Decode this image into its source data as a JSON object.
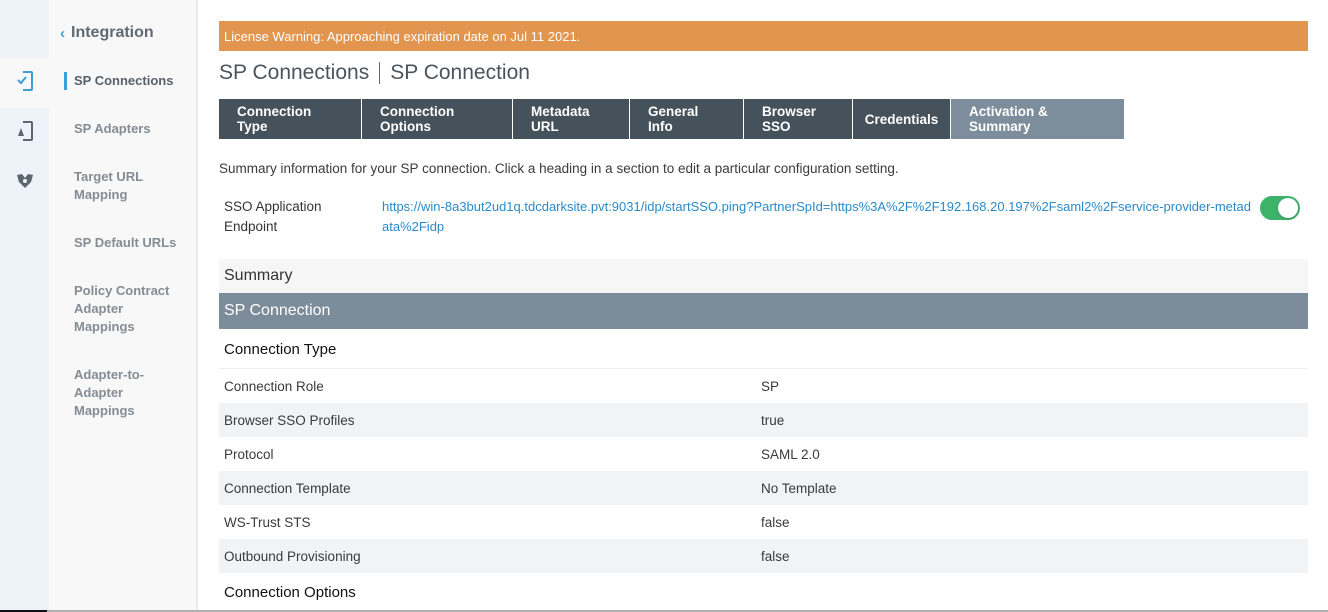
{
  "rail": {
    "items": [
      {
        "icon": "sp-connections-icon",
        "active": true
      },
      {
        "icon": "sp-adapters-icon",
        "active": false
      },
      {
        "icon": "mappings-icon",
        "active": false
      }
    ]
  },
  "subnav": {
    "back_label": "Integration",
    "back_icon": "chevron-left-icon",
    "items": [
      {
        "label": "SP Connections",
        "active": true
      },
      {
        "label": "SP Adapters",
        "active": false
      },
      {
        "label": "Target URL Mapping",
        "active": false
      },
      {
        "label": "SP Default URLs",
        "active": false
      },
      {
        "label": "Policy Contract Adapter Mappings",
        "active": false
      },
      {
        "label": "Adapter-to-Adapter Mappings",
        "active": false
      }
    ]
  },
  "license_warning": "License Warning: Approaching expiration date on Jul 11 2021.",
  "title": {
    "parent": "SP Connections",
    "current": "SP Connection"
  },
  "tabs": [
    {
      "label": "Connection Type",
      "active": false
    },
    {
      "label": "Connection Options",
      "active": false
    },
    {
      "label": "Metadata URL",
      "active": false
    },
    {
      "label": "General Info",
      "active": false
    },
    {
      "label": "Browser SSO",
      "active": false
    },
    {
      "label": "Credentials",
      "active": false
    },
    {
      "label": "Activation & Summary",
      "active": true
    }
  ],
  "intro": "Summary information for your SP connection. Click a heading in a section to edit a particular configuration setting.",
  "sso_endpoint": {
    "label": "SSO Application Endpoint",
    "url": "https://win-8a3but2ud1q.tdcdarksite.pvt:9031/idp/startSSO.ping?PartnerSpId=https%3A%2F%2F192.168.20.197%2Fsaml2%2Fservice-provider-metadata%2Fidp",
    "enabled": true,
    "toggle_color": "#3db36a"
  },
  "summary": {
    "header": "Summary",
    "connection_header": "SP Connection",
    "sections": [
      {
        "title": "Connection Type",
        "rows": [
          {
            "label": "Connection Role",
            "value": "SP"
          },
          {
            "label": "Browser SSO Profiles",
            "value": "true"
          },
          {
            "label": "Protocol",
            "value": "SAML 2.0"
          },
          {
            "label": "Connection Template",
            "value": "No Template"
          },
          {
            "label": "WS-Trust STS",
            "value": "false"
          },
          {
            "label": "Outbound Provisioning",
            "value": "false"
          }
        ]
      },
      {
        "title": "Connection Options",
        "rows": []
      }
    ]
  },
  "colors": {
    "license_bg": "#e2954e",
    "tab_bg": "#45525c",
    "tab_active_bg": "#7e8d9c",
    "accent": "#3c9ed3",
    "link": "#2a8ac8"
  }
}
